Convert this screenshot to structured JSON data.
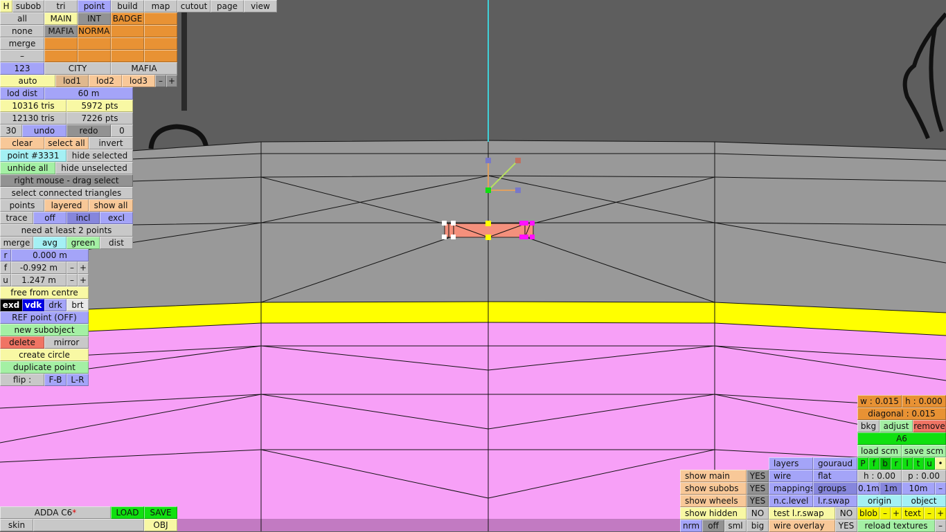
{
  "tabs": {
    "h": "H",
    "items": [
      "subob",
      "tri",
      "point",
      "build",
      "map",
      "cutout",
      "page",
      "view"
    ],
    "active": "point"
  },
  "layers": {
    "all": "all",
    "none": "none",
    "merge": "merge",
    "minus": "–",
    "main": "MAIN",
    "int": "INT",
    "badge": "BADGE",
    "mafia": "MAFIA",
    "normal": "NORMAL"
  },
  "set": {
    "num": "123",
    "city": "CITY",
    "mafia": "MAFIA"
  },
  "lod": {
    "auto": "auto",
    "lod1": "lod1",
    "lod2": "lod2",
    "lod3": "lod3",
    "minus": "–",
    "plus": "+",
    "dist_label": "lod dist",
    "dist_value": "60 m"
  },
  "stats": {
    "tris1": "10316 tris",
    "pts1": "5972 pts",
    "tris2": "12130 tris",
    "pts2": "7226 pts"
  },
  "history": {
    "undo_count": "30",
    "undo": "undo",
    "redo": "redo",
    "redo_count": "0"
  },
  "select": {
    "clear": "clear",
    "select_all": "select all",
    "invert": "invert",
    "point": "point #3331",
    "hide_selected": "hide selected",
    "unhide_all": "unhide all",
    "hide_unselected": "hide unselected",
    "drag": "right mouse - drag select",
    "connected": "select connected triangles",
    "points": "points",
    "layered": "layered",
    "show_all": "show all",
    "trace": "trace",
    "off": "off",
    "incl": "incl",
    "excl": "excl",
    "need": "need at least 2 points",
    "merge": "merge",
    "avg": "avg",
    "green": "green",
    "dist": "dist"
  },
  "coords": {
    "r_label": "r",
    "r": "0.000 m",
    "f_label": "f",
    "f": "-0.992 m",
    "u_label": "u",
    "u": "1.247 m",
    "minus": "–",
    "plus": "+"
  },
  "tools": {
    "free": "free from centre",
    "exd": "exd",
    "vdk": "vdk",
    "drk": "drk",
    "brt": "brt",
    "ref": "REF point (OFF)",
    "new_sub": "new subobject",
    "delete": "delete",
    "mirror": "mirror",
    "circle": "create circle",
    "duplicate": "duplicate point",
    "flip": "flip :",
    "fb": "F-B",
    "lr": "L-R"
  },
  "file": {
    "name": "ADDA C6",
    "modified": "*",
    "load": "LOAD",
    "save": "SAVE",
    "skin": "skin",
    "skin_value": "",
    "obj": "OBJ"
  },
  "measure": {
    "w": "w : 0.015",
    "h": "h : 0.000",
    "diagonal": "diagonal : 0.015",
    "bkg": "bkg",
    "adjust": "adjust",
    "remove": "remove",
    "a6": "A6",
    "load_scm": "load scm",
    "save_scm": "save scm"
  },
  "views": [
    "P",
    "f",
    "b",
    "r",
    "l",
    "t",
    "u",
    "•"
  ],
  "cam": {
    "h": "h : 0.00",
    "p": "p : 0.00",
    "s01": "0.1m",
    "s1": "1m",
    "s10": "10m",
    "minus": "–",
    "origin": "origin",
    "object": "object",
    "blob": "blob",
    "text": "text",
    "plus": "+",
    "reload": "reload textures"
  },
  "render": {
    "layers": "layers",
    "gouraud": "gouraud",
    "wire": "wire",
    "flat": "flat",
    "mappings": "mappings",
    "groups": "groups",
    "nclevel": "n.c.level",
    "lrswap": "l.r.swap",
    "test_lrswap": "test l.r.swap",
    "test_val": "NO",
    "wire_overlay": "wire overlay",
    "wire_overlay_val": "YES"
  },
  "show": {
    "main": "show main",
    "main_val": "YES",
    "subobs": "show subobs",
    "subobs_val": "YES",
    "wheels": "show wheels",
    "wheels_val": "YES",
    "hidden": "show hidden",
    "hidden_val": "NO",
    "nrm": "nrm",
    "off": "off",
    "sml": "sml",
    "big": "big"
  },
  "colors": {
    "floor": "#999999",
    "stripe": "#ffff00",
    "body": "#f7a0f7",
    "selection": "#f4907c",
    "axis": "#40d0d8"
  }
}
